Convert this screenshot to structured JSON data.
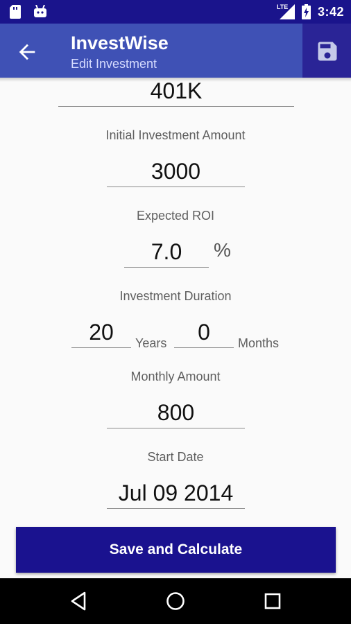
{
  "status_bar": {
    "time": "3:42",
    "network_label": "LTE",
    "icons": [
      "sd-card-icon",
      "android-icon",
      "signal-icon",
      "battery-icon"
    ]
  },
  "app_bar": {
    "title": "InvestWise",
    "subtitle": "Edit Investment",
    "back_icon": "arrow-back-icon",
    "save_icon": "floppy-disk-icon"
  },
  "form": {
    "investment_name": "401K",
    "initial_amount": {
      "label": "Initial Investment Amount",
      "value": "3000"
    },
    "roi": {
      "label": "Expected ROI",
      "value": "7.0",
      "unit": "%"
    },
    "duration": {
      "label": "Investment Duration",
      "years_value": "20",
      "years_unit": "Years",
      "months_value": "0",
      "months_unit": "Months"
    },
    "monthly_amount": {
      "label": "Monthly Amount",
      "value": "800"
    },
    "start_date": {
      "label": "Start Date",
      "value": "Jul 09 2014"
    }
  },
  "actions": {
    "save_calculate": "Save and Calculate"
  },
  "nav_bar": {
    "icons": [
      "back-triangle-icon",
      "home-circle-icon",
      "recents-square-icon"
    ]
  },
  "colors": {
    "status_bar": "#1a148c",
    "app_bar": "#3f51b5",
    "button": "#1a128f",
    "background": "#fafafa"
  }
}
